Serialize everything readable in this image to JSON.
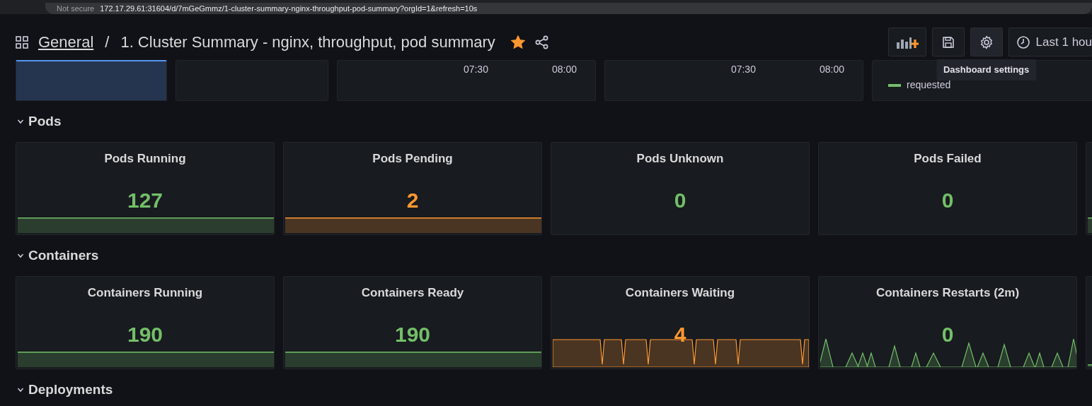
{
  "browser": {
    "security": "Not secure",
    "url": "172.17.29.61:31604/d/7mGeGmmz/1-cluster-summary-nginx-throughput-pod-summary?orgId=1&refresh=10s"
  },
  "header": {
    "folder": "General",
    "separator": "/",
    "title": "1. Cluster Summary - nginx, throughput, pod summary",
    "starred": true,
    "tooltip": "Dashboard settings",
    "time_range": "Last 1 hou"
  },
  "top_panels": [
    {
      "kind": "fill"
    },
    {
      "kind": "empty"
    },
    {
      "kind": "axis",
      "ticks": [
        "07:30",
        "08:00"
      ]
    },
    {
      "kind": "axis",
      "ticks": [
        "07:30",
        "08:00"
      ]
    },
    {
      "kind": "legend",
      "legend": [
        {
          "label": "requested",
          "color": "#73bf69"
        }
      ]
    }
  ],
  "rows": [
    {
      "title": "Pods",
      "expanded": true,
      "panels": [
        {
          "kind": "stat",
          "title": "Pods Running",
          "value": "127",
          "color": "#73bf69",
          "sparkline": {
            "kind": "flat"
          }
        },
        {
          "kind": "stat",
          "title": "Pods Pending",
          "value": "2",
          "color": "#ff9830",
          "sparkline": {
            "kind": "flat"
          }
        },
        {
          "kind": "stat",
          "title": "Pods Unknown",
          "value": "0",
          "color": "#73bf69"
        },
        {
          "kind": "stat",
          "title": "Pods Failed",
          "value": "0",
          "color": "#73bf69"
        },
        {
          "kind": "stub",
          "color": "#73bf69",
          "sparkline": {
            "kind": "flat"
          }
        }
      ]
    },
    {
      "title": "Containers",
      "expanded": true,
      "panels": [
        {
          "kind": "stat",
          "title": "Containers Running",
          "value": "190",
          "color": "#73bf69",
          "sparkline": {
            "kind": "flat"
          }
        },
        {
          "kind": "stat",
          "title": "Containers Ready",
          "value": "190",
          "color": "#73bf69",
          "sparkline": {
            "kind": "flat"
          }
        },
        {
          "kind": "stat",
          "title": "Containers Waiting",
          "value": "4",
          "color": "#ff9830",
          "sparkline": {
            "kind": "dips"
          }
        },
        {
          "kind": "stat",
          "title": "Containers Restarts (2m)",
          "value": "0",
          "color": "#73bf69",
          "sparkline": {
            "kind": "spikes"
          }
        },
        {
          "kind": "stub",
          "color": "#73bf69",
          "sparkline": {
            "kind": "low"
          }
        }
      ]
    },
    {
      "title": "Deployments",
      "expanded": true
    }
  ]
}
